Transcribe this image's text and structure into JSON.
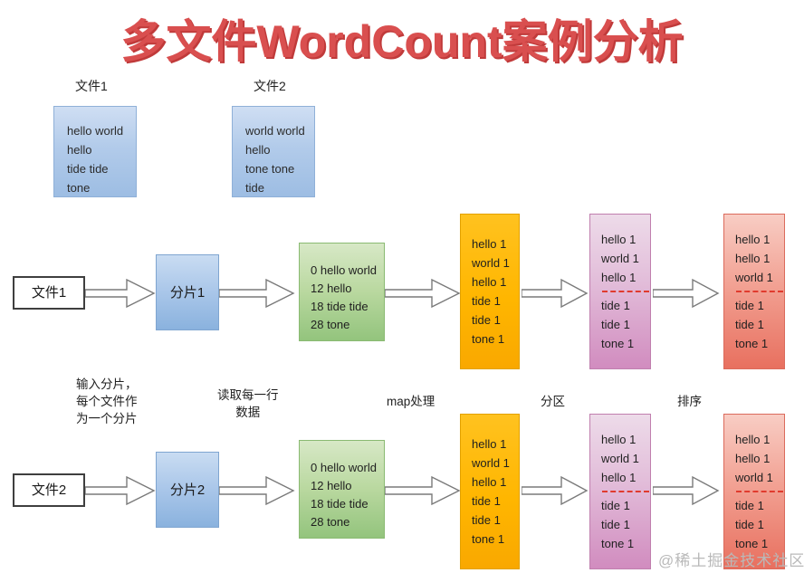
{
  "title": "多文件WordCount案例分析",
  "file_headers": [
    {
      "label": "文件1"
    },
    {
      "label": "文件2"
    }
  ],
  "file_contents": [
    {
      "lines": [
        "hello world",
        "hello",
        "tide tide",
        "tone"
      ]
    },
    {
      "lines": [
        "world world",
        "hello",
        "tone tone",
        "tide"
      ]
    }
  ],
  "captions": {
    "input_split": "输入分片，\n每个文件作\n为一个分片",
    "input_split_lines": [
      "输入分片，",
      "每个文件作",
      "为一个分片"
    ],
    "read_line": "读取每一行\n数据",
    "read_line_lines": [
      "读取每一行",
      "数据"
    ],
    "map_process": "map处理",
    "partition": "分区",
    "sort": "排序"
  },
  "rows": [
    {
      "source_label": "文件1",
      "split_label": "分片1",
      "record_lines": [
        "0 hello world",
        "12 hello",
        "18 tide tide",
        "28 tone"
      ],
      "map_lines": [
        "hello 1",
        "world 1",
        "hello 1",
        "tide 1",
        "tide 1",
        "tone 1"
      ],
      "partition_group_a": [
        "hello 1",
        "world 1",
        "hello 1"
      ],
      "partition_group_b": [
        "tide 1",
        "tide 1",
        "tone 1"
      ],
      "sort_group_a": [
        "hello 1",
        "hello 1",
        "world 1"
      ],
      "sort_group_b": [
        "tide 1",
        "tide 1",
        "tone 1"
      ]
    },
    {
      "source_label": "文件2",
      "split_label": "分片2",
      "record_lines": [
        "0 hello world",
        "12 hello",
        "18 tide tide",
        "28 tone"
      ],
      "map_lines": [
        "hello 1",
        "world 1",
        "hello 1",
        "tide 1",
        "tide 1",
        "tone 1"
      ],
      "partition_group_a": [
        "hello 1",
        "world 1",
        "hello 1"
      ],
      "partition_group_b": [
        "tide 1",
        "tide 1",
        "tone 1"
      ],
      "sort_group_a": [
        "hello 1",
        "hello 1",
        "world 1"
      ],
      "sort_group_b": [
        "tide 1",
        "tide 1",
        "tone 1"
      ]
    }
  ],
  "watermark": "@稀土掘金技术社区",
  "colors": {
    "title": "#d94f4f",
    "file_box": "#a9c6e9",
    "split_box": "#8ab2de",
    "record_box": "#93c47d",
    "map_box": "#ffb600",
    "partition_box": "#d18cbf",
    "sort_box": "#e8705f",
    "divider": "#e03b2e",
    "arrow_outline": "#7a7a7a"
  }
}
